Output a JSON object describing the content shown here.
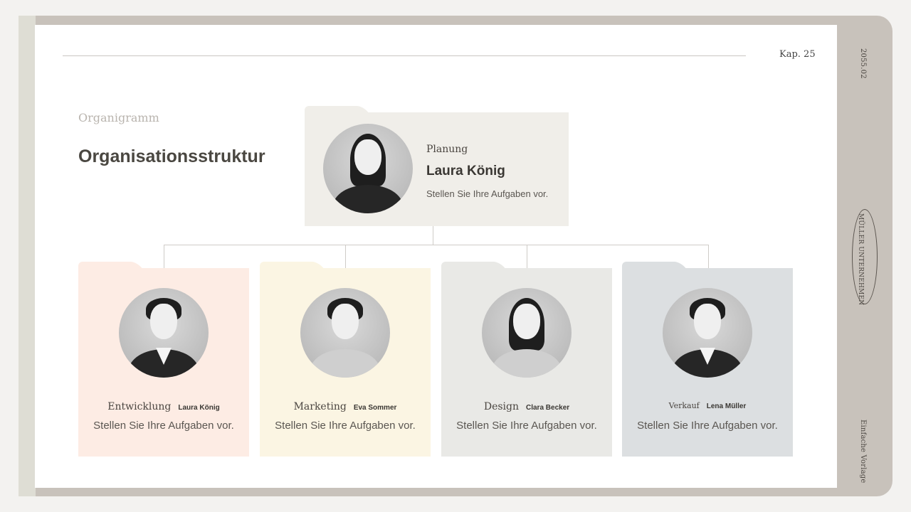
{
  "header": {
    "chapter": "Kap. 25"
  },
  "sidebar": {
    "date": "2055.02",
    "company": "MÜLLER UNTERNEHMEN",
    "template": "Einfache Vorlage"
  },
  "title": {
    "eyebrow": "Organigramm",
    "main": "Organisationsstruktur"
  },
  "top": {
    "department": "Planung",
    "name": "Laura König",
    "description": "Stellen Sie Ihre Aufgaben vor.",
    "color": "#f0eee9"
  },
  "members": [
    {
      "department": "Entwicklung",
      "name": "Laura König",
      "description": "Stellen Sie Ihre Aufgaben vor.",
      "color": "#fdece4"
    },
    {
      "department": "Marketing",
      "name": "Eva Sommer",
      "description": "Stellen Sie Ihre Aufgaben vor.",
      "color": "#fbf5e3"
    },
    {
      "department": "Design",
      "name": "Clara Becker",
      "description": "Stellen Sie Ihre Aufgaben vor.",
      "color": "#e9e9e6"
    },
    {
      "department": "Verkauf",
      "name": "Lena Müller",
      "description": "Stellen Sie Ihre Aufgaben vor.",
      "color": "#dcdfe1"
    }
  ]
}
